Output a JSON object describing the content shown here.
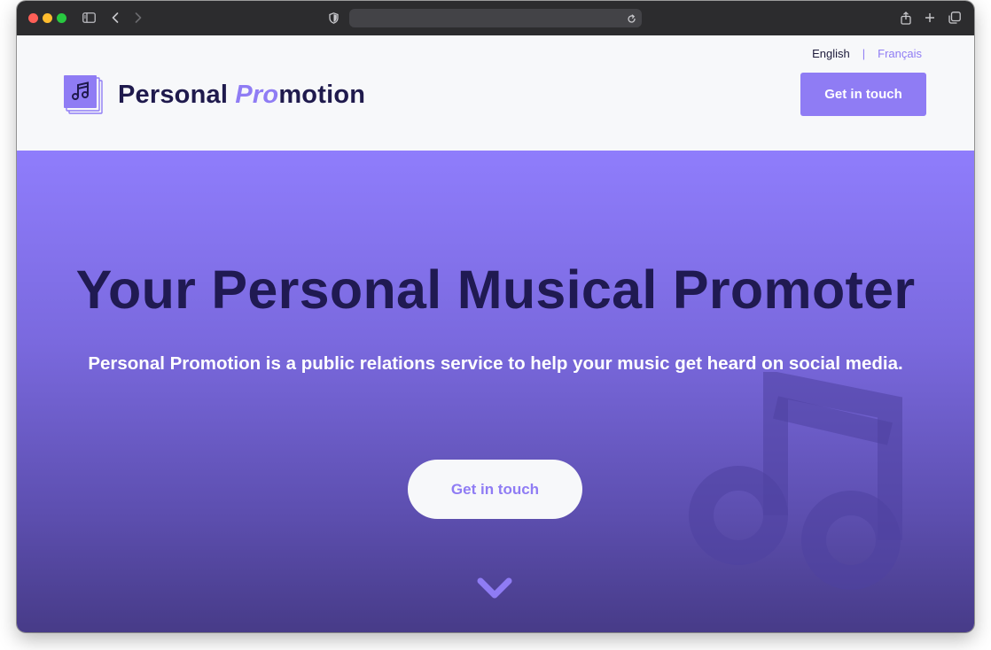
{
  "browser": {
    "icons": [
      "sidebar-icon",
      "back-icon",
      "forward-icon",
      "shield-icon",
      "reload-icon",
      "share-icon",
      "new-tab-icon",
      "tabs-overview-icon"
    ]
  },
  "header": {
    "languages": {
      "english": "English",
      "separator": "|",
      "french": "Français"
    },
    "logo": {
      "text_part1": "Personal ",
      "text_pro": "Pro",
      "text_part2": "motion",
      "icon": "music-note-icon"
    },
    "cta_label": "Get in touch"
  },
  "hero": {
    "title": "Your Personal Musical Promoter",
    "subtitle": "Personal Promotion is a public relations service to help your music get heard on social media.",
    "cta_label": "Get in touch",
    "scroll_icon": "chevron-down-icon"
  },
  "colors": {
    "accent": "#8f7cf4",
    "dark_text": "#1f1a4d",
    "header_bg": "#f7f8fa"
  }
}
